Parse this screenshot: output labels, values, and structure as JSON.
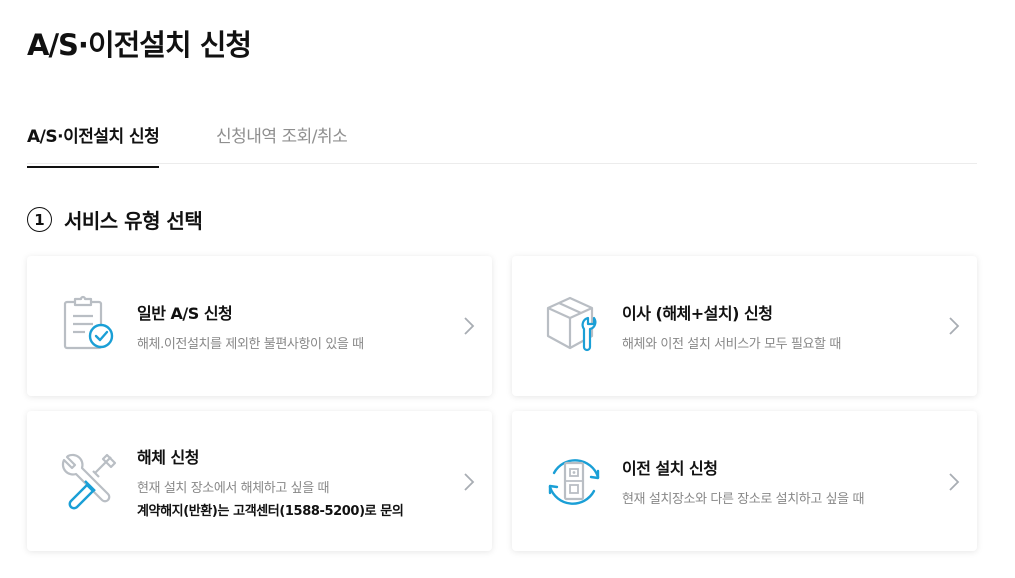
{
  "page": {
    "title": "A/S·이전설치 신청"
  },
  "tabs": [
    {
      "label": "A/S·이전설치 신청",
      "active": true
    },
    {
      "label": "신청내역 조회/취소",
      "active": false
    }
  ],
  "section": {
    "step": "1",
    "title": "서비스 유형 선택"
  },
  "cards": {
    "general": {
      "title": "일반 A/S 신청",
      "desc": "해체.이전설치를 제외한 불편사항이 있을 때",
      "icon": "clipboard-check-icon"
    },
    "move": {
      "title": "이사 (해체+설치) 신청",
      "desc": "해체와 이전 설치 서비스가 모두 필요할 때",
      "icon": "box-wrench-icon"
    },
    "dismantle": {
      "title": "해체 신청",
      "desc": "현재 설치 장소에서 해체하고 싶을 때",
      "desc_strong": "계약해지(반환)는 고객센터(1588-5200)로 문의",
      "icon": "tools-icon"
    },
    "relocate": {
      "title": "이전 설치 신청",
      "desc": "현재 설치장소와 다른 장소로 설치하고 싶을 때",
      "icon": "relocate-icon"
    }
  },
  "colors": {
    "accent": "#1a9fd6",
    "icon_gray": "#b9bec4",
    "text": "#111111",
    "muted": "#888888"
  }
}
